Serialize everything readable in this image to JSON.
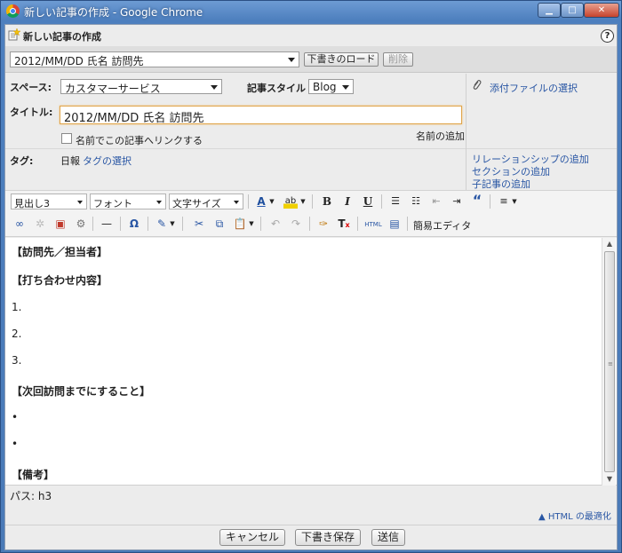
{
  "window": {
    "title": "新しい記事の作成 - Google Chrome",
    "min_label": "▁",
    "max_label": "□",
    "close_label": "✕"
  },
  "header": {
    "title": "新しい記事の作成",
    "help_label": "?"
  },
  "draft": {
    "selected": "2012/MM/DD 氏名 訪問先",
    "load_label": "下書きのロード",
    "delete_label": "削除"
  },
  "form": {
    "space_label": "スペース:",
    "space_value": "カスタマーサービス",
    "style_label": "記事スタイル",
    "style_value": "Blog",
    "title_label": "タイトル:",
    "title_value": "2012/MM/DD 氏名 訪問先",
    "link_checkbox_label": "名前でこの記事へリンクする",
    "add_name_link": "名前の追加",
    "tags_label": "タグ:",
    "tag_value": "日報",
    "tag_select_link": "タグの選択"
  },
  "sidebar": {
    "attach_link": "添付ファイルの選択",
    "relationship_link": "リレーションシップの追加",
    "section_link": "セクションの追加",
    "child_article_link": "子記事の追加"
  },
  "toolbar": {
    "heading_value": "見出し3",
    "font_value": "フォント",
    "size_value": "文字サイズ",
    "simple_editor_label": "簡易エディタ",
    "html_label": "HTML"
  },
  "editor": {
    "lines": [
      "【訪問先／担当者】",
      "【打ち合わせ内容】",
      "1.",
      "2.",
      "3.",
      "【次回訪問までにすること】",
      "•",
      "•",
      "【備考】"
    ]
  },
  "status": {
    "path": "パス: h3",
    "html_optimize_link": "▲ HTML の最適化"
  },
  "footer": {
    "cancel_label": "キャンセル",
    "save_draft_label": "下書き保存",
    "submit_label": "送信"
  }
}
